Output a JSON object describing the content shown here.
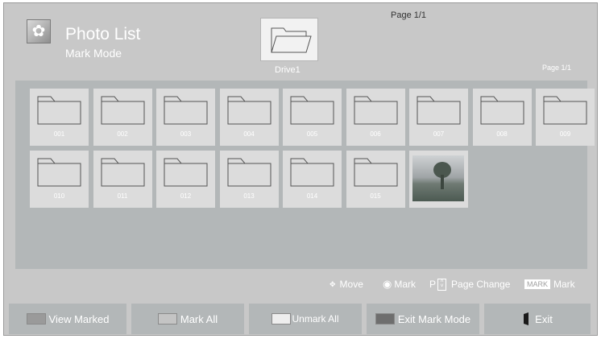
{
  "header": {
    "title": "Photo List",
    "subtitle": "Mark Mode",
    "icon": "flower-photo-icon",
    "page_top": "Page 1/1",
    "page_right": "Page 1/1"
  },
  "drive": {
    "label": "Drive1",
    "icon": "open-folder-icon"
  },
  "grid": {
    "folders": [
      "001",
      "002",
      "003",
      "004",
      "005",
      "006",
      "007",
      "008",
      "009",
      "010",
      "011",
      "012",
      "013",
      "014",
      "015"
    ],
    "photo": {
      "icon": "tree-photo-thumbnail"
    }
  },
  "legend": {
    "move": "Move",
    "mark": "Mark",
    "page_prefix": "P",
    "page_change": "Page Change",
    "mark_badge": "MARK",
    "mark_label": "Mark"
  },
  "buttons": {
    "view_marked": "View Marked",
    "mark_all": "Mark All",
    "unmark_all": "Unmark All",
    "exit_mark_mode": "Exit Mark Mode",
    "exit": "Exit"
  },
  "colors": {
    "background": "#c8c8c8",
    "grid": "#b3b7b8",
    "tile": "#dcdcdc",
    "text": "#ffffff",
    "swatch_view_marked": "#9a9a9a",
    "swatch_mark_all": "#c4c4c4",
    "swatch_unmark_all": "#eeeeee",
    "swatch_exit_mark_mode": "#6e6e6e"
  }
}
